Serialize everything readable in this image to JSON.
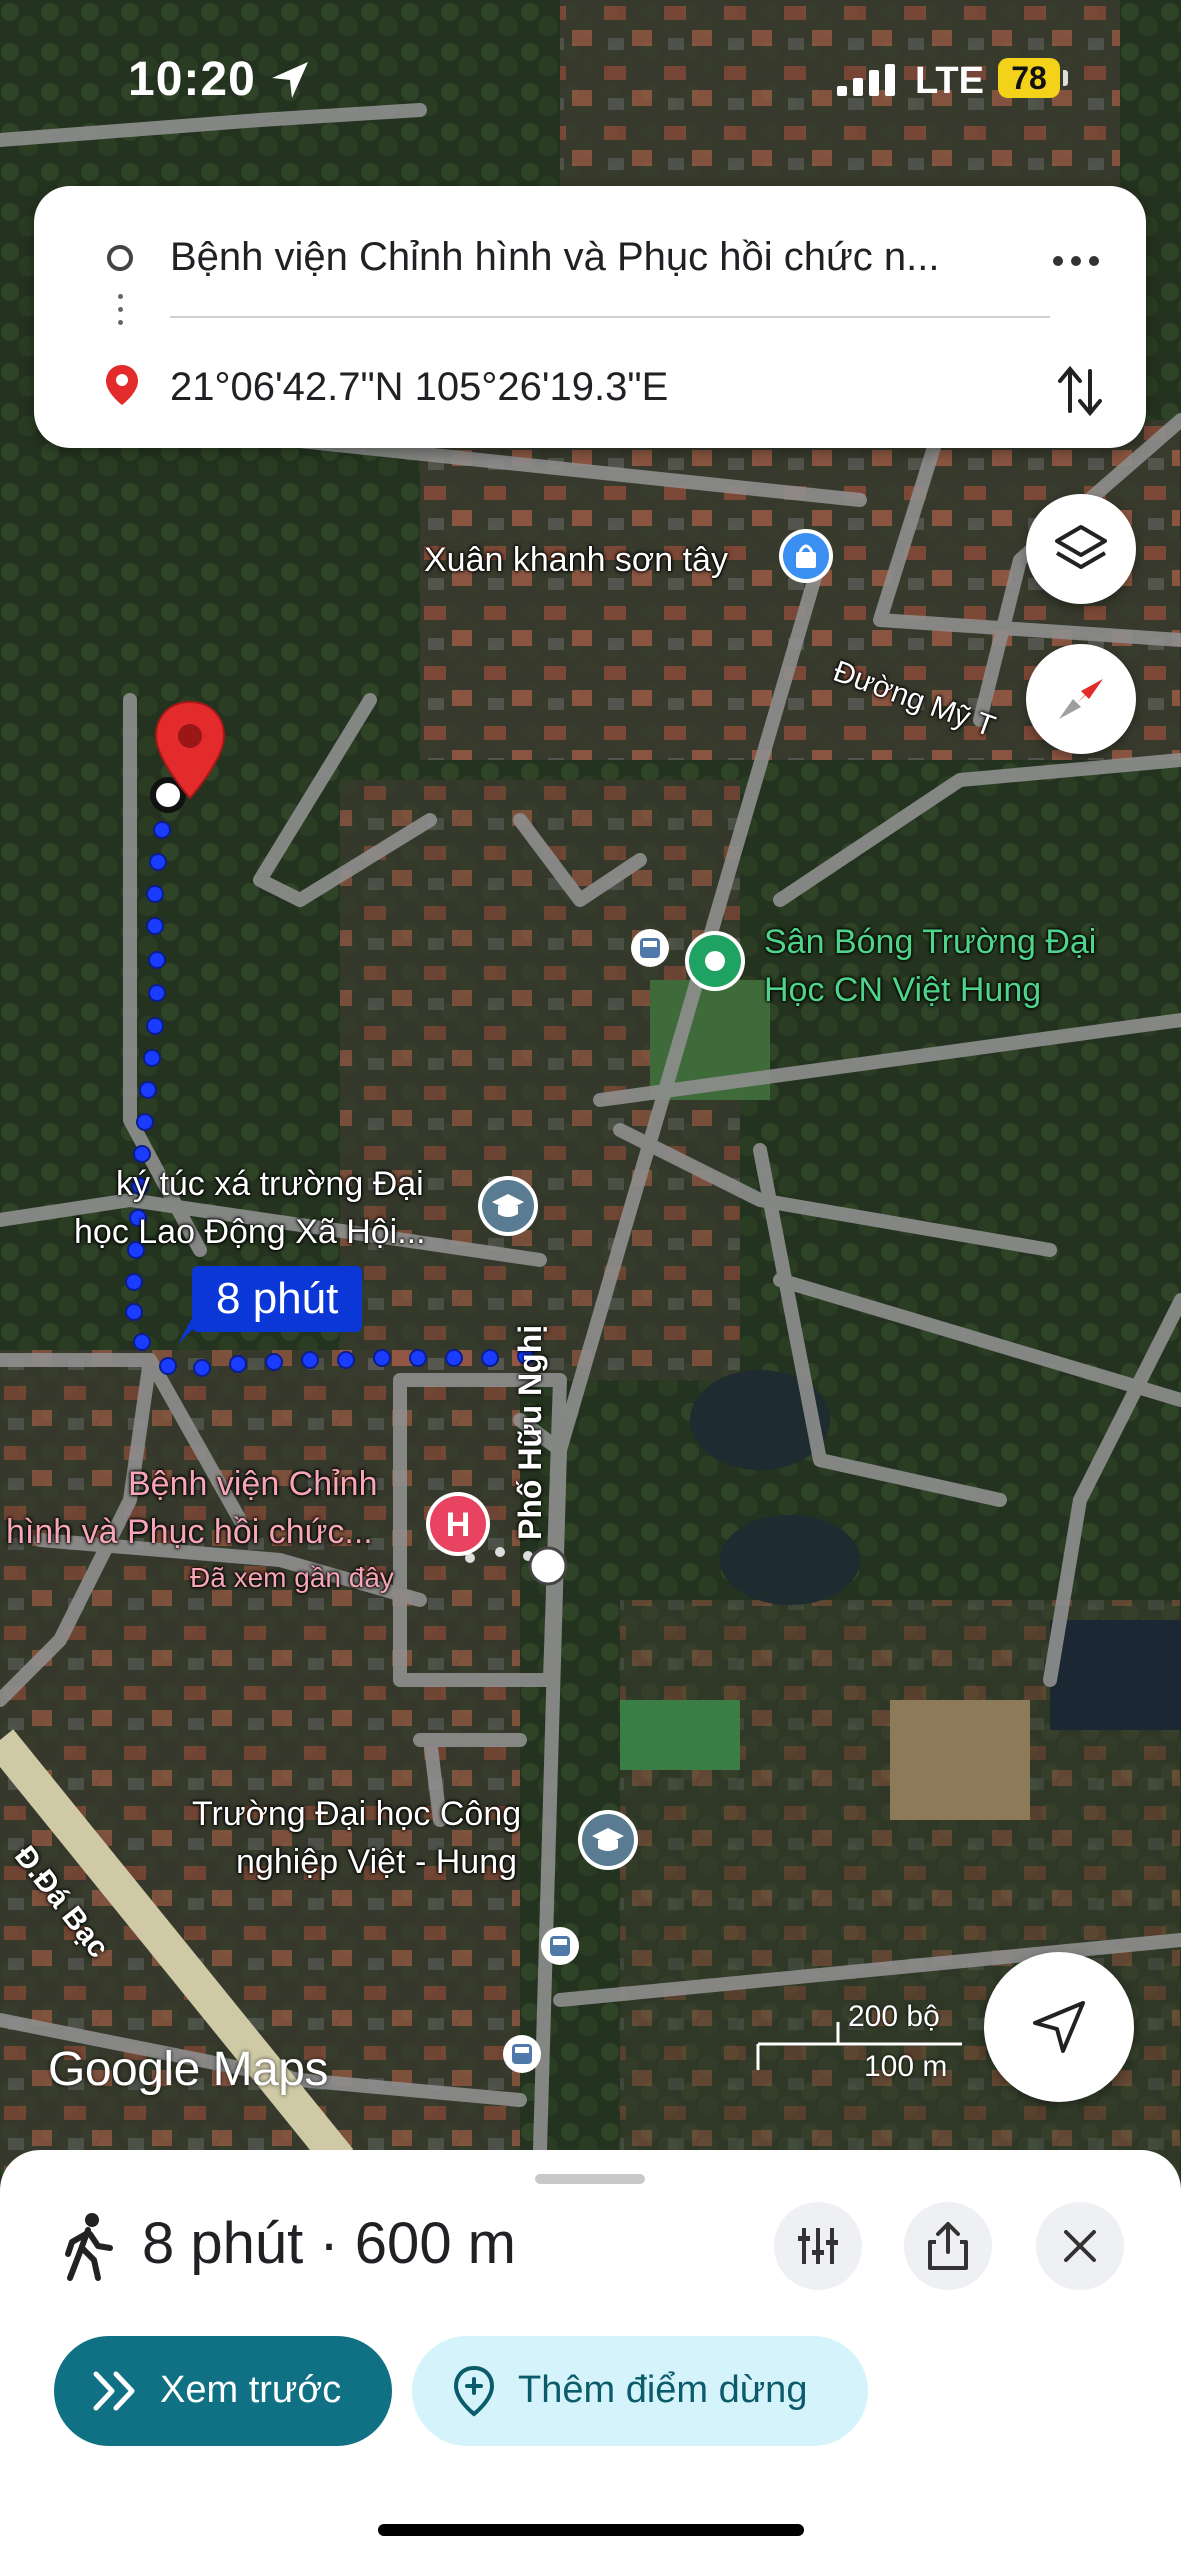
{
  "status_bar": {
    "time": "10:20",
    "network": "LTE",
    "battery": "78"
  },
  "route_card": {
    "origin": "Bệnh viện Chỉnh hình và Phục hồi chức n...",
    "destination": "21°06'42.7\"N 105°26'19.3\"E"
  },
  "map": {
    "labels": {
      "poi_xuan_khanh": "Xuân khanh sơn tây",
      "road_duong_my": "Đường Mỹ T",
      "poi_san_bong_1": "Sân Bóng Trường Đại",
      "poi_san_bong_2": "Học CN Việt Hung",
      "poi_ktx_1": "ký túc xá trường Đại",
      "poi_ktx_2": "học Lao Động Xã Hội...",
      "route_time": "8 phút",
      "street_pho_huu_nghi": "Phố Hữu Nghị",
      "poi_benh_vien_1": "Bệnh viện Chỉnh",
      "poi_benh_vien_2": "hình và Phục hồi chức...",
      "poi_benh_vien_note": "Đã xem gần đây",
      "poi_truong_1": "Trường Đại học Công",
      "poi_truong_2": "nghiệp Việt - Hung",
      "street_da_bac": "Đ.Đá Bạc",
      "watermark": "Google Maps",
      "scale_ft": "200 bộ",
      "scale_m": "100 m"
    },
    "colors": {
      "route": "#1a3cff",
      "destination_pin": "#e32b2b",
      "accent": "#0f7183"
    }
  },
  "bottom_sheet": {
    "summary": "8 phút · 600 m",
    "preview_label": "Xem trước",
    "add_stop_label": "Thêm điểm dừng"
  }
}
